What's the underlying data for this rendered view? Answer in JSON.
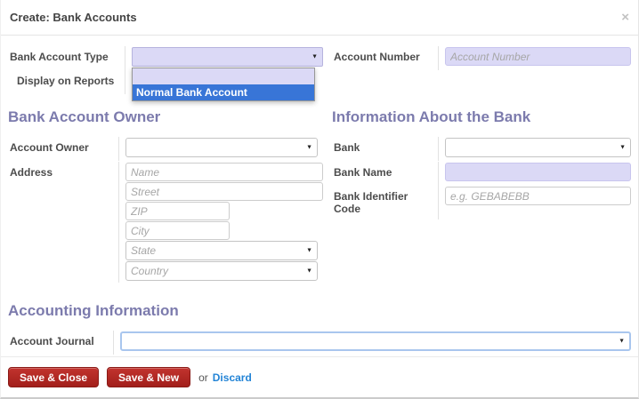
{
  "dialog": {
    "title": "Create: Bank Accounts",
    "close_icon": "×"
  },
  "top_form": {
    "bank_account_type": {
      "label": "Bank Account Type",
      "selected_value": ""
    },
    "type_dropdown": {
      "options": [
        "",
        "Normal Bank Account"
      ],
      "highlighted_option": "Normal Bank Account"
    },
    "display_on_reports": {
      "label": "Display on Reports"
    },
    "account_number": {
      "label": "Account Number",
      "value": "",
      "placeholder": "Account Number"
    }
  },
  "bank_account_owner": {
    "heading": "Bank Account Owner",
    "account_owner": {
      "label": "Account Owner",
      "selected_value": ""
    },
    "address": {
      "label": "Address",
      "name_placeholder": "Name",
      "street_placeholder": "Street",
      "zip_placeholder": "ZIP",
      "city_placeholder": "City",
      "state_placeholder": "State",
      "country_placeholder": "Country"
    }
  },
  "information_about_bank": {
    "heading": "Information About the Bank",
    "bank": {
      "label": "Bank",
      "selected_value": ""
    },
    "bank_name": {
      "label": "Bank Name",
      "value": ""
    },
    "bank_identifier_code": {
      "label": "Bank Identifier Code",
      "value": "",
      "placeholder": "e.g. GEBABEBB"
    }
  },
  "accounting_information": {
    "heading": "Accounting Information",
    "account_journal": {
      "label": "Account Journal",
      "selected_value": ""
    }
  },
  "footer": {
    "save_and_close": "Save & Close",
    "save_and_new": "Save & New",
    "or_text": "or",
    "discard": "Discard"
  },
  "colors": {
    "heading_purple": "#7c7bad",
    "required_field_bg": "#dbd9f6",
    "dropdown_highlight_blue": "#3875d7",
    "save_button_red": "#b1261f",
    "discard_link_blue": "#2384d6"
  }
}
